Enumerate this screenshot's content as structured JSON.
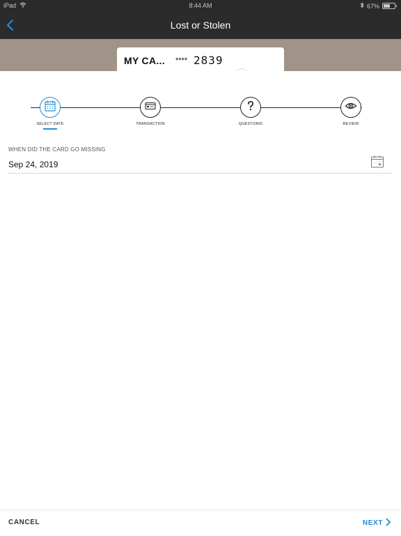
{
  "status_bar": {
    "device": "iPad",
    "time": "8:44 AM",
    "battery_text": "67%",
    "battery_level": 0.67
  },
  "nav": {
    "title": "Lost or Stolen",
    "back_icon": "chevron-left-icon"
  },
  "card": {
    "name": "MY CA...",
    "mask": "****",
    "last4": "2839"
  },
  "steps": [
    {
      "label": "SELECT DATE",
      "icon": "calendar-icon",
      "active": true
    },
    {
      "label": "TRANSACTION",
      "icon": "credit-card-icon",
      "active": false
    },
    {
      "label": "QUESTIONS",
      "icon": "question-icon",
      "active": false
    },
    {
      "label": "REVIEW",
      "icon": "eye-icon",
      "active": false
    }
  ],
  "date_field": {
    "label": "WHEN DID THE CARD GO MISSING",
    "value": "Sep 24, 2019"
  },
  "footer": {
    "cancel_label": "CANCEL",
    "next_label": "NEXT"
  },
  "colors": {
    "accent": "#1f8dd6",
    "nav_background": "#2b2b2b",
    "banner_background": "#a09489"
  }
}
